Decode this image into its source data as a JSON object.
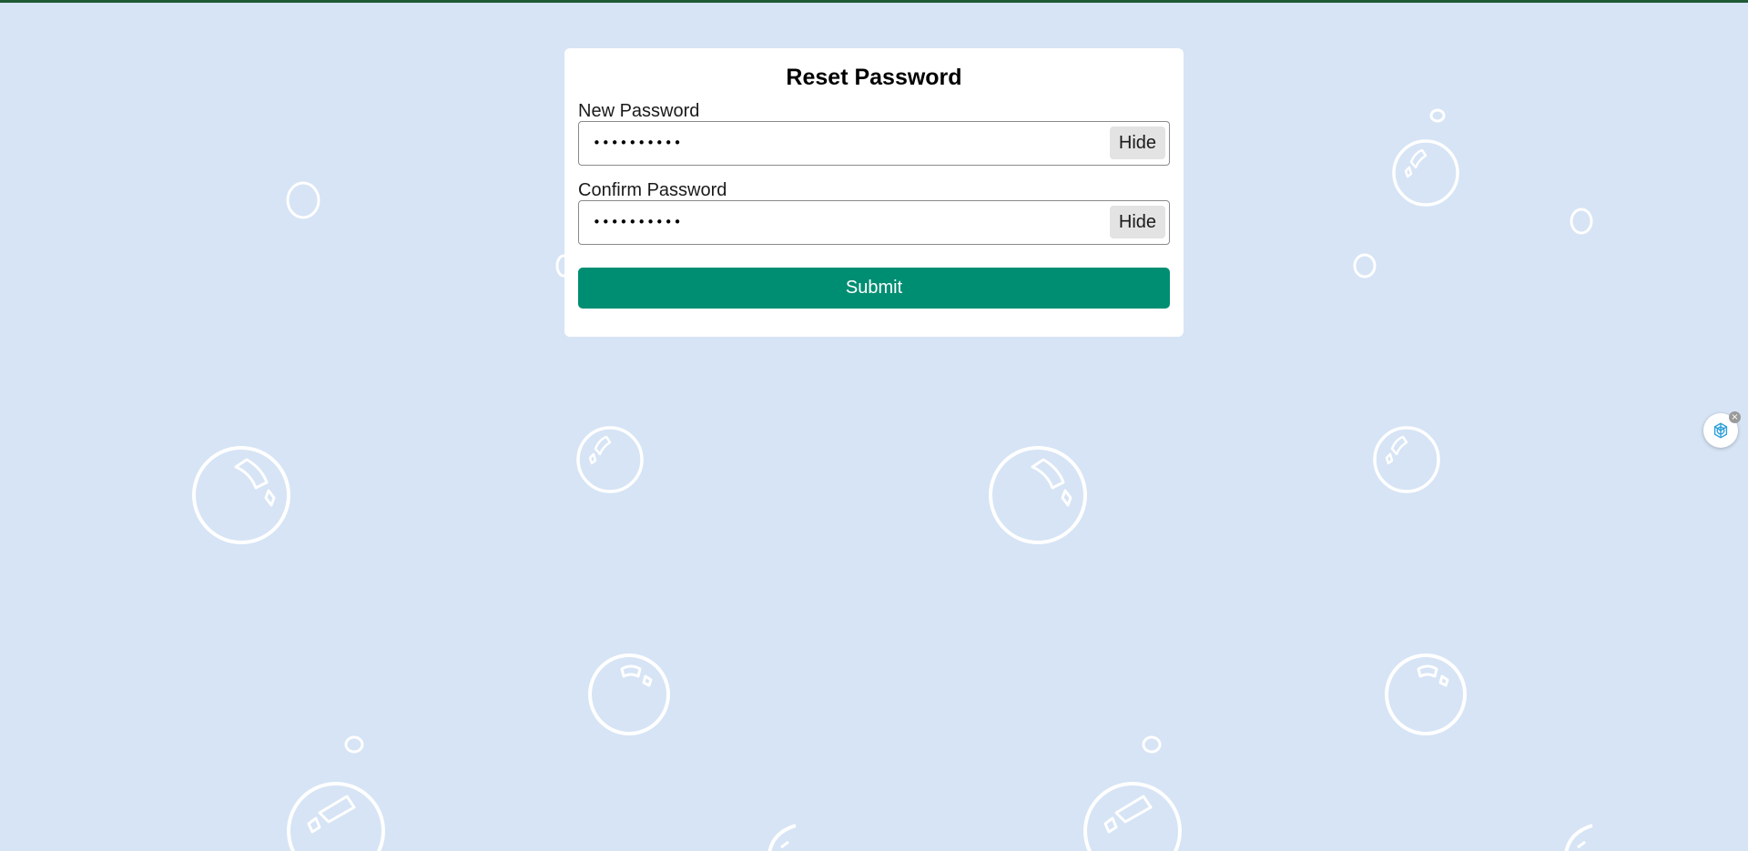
{
  "form": {
    "title": "Reset Password",
    "new_password": {
      "label": "New Password",
      "value": "••••••••••",
      "toggle_label": "Hide"
    },
    "confirm_password": {
      "label": "Confirm Password",
      "value": "••••••••••",
      "toggle_label": "Hide"
    },
    "submit_label": "Submit"
  },
  "floating_widget": {
    "icon": "openai-logo-icon",
    "close_symbol": "×"
  },
  "colors": {
    "background": "#d6e4f5",
    "top_border": "#1f5a34",
    "card": "#ffffff",
    "submit_button": "#008e72",
    "hide_button": "#e3e3e3",
    "bubble_outline": "#ffffff"
  }
}
